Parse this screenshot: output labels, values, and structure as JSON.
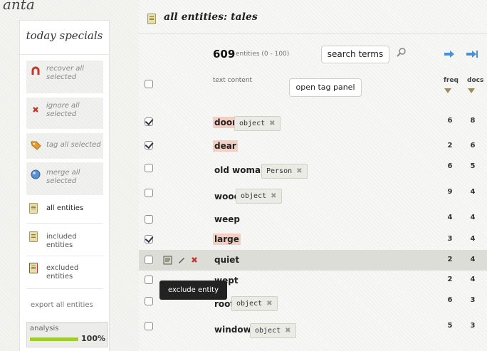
{
  "app": {
    "brand": "anta"
  },
  "sidebar": {
    "title": "today specials",
    "actions": [
      {
        "label": "recover all selected",
        "icon": "horseshoe-icon"
      },
      {
        "label": "ignore all selected",
        "icon": "red-x-icon"
      },
      {
        "label": "tag all selected",
        "icon": "tag-icon"
      },
      {
        "label": "merge all selected",
        "icon": "merge-icon"
      }
    ],
    "links": [
      {
        "label": "all entities",
        "icon": "document-icon"
      },
      {
        "label": "included entities",
        "icon": "document-check-icon"
      },
      {
        "label": "excluded entities",
        "icon": "document-excluded-icon"
      }
    ],
    "export_label": "export all entities",
    "analysis": {
      "label": "analysis",
      "progress": "100%",
      "progress_value": 1.0
    }
  },
  "main": {
    "title": "all entities: tales",
    "count": "609",
    "count_sub": "entities (0 - 100)",
    "search_button": "search terms",
    "columns": {
      "content": "text content",
      "freq": "freq",
      "docs": "docs"
    },
    "tag_panel_button": "open tag panel",
    "rows": [
      {
        "word": "door",
        "tag": "object",
        "freq": "6",
        "docs": "8",
        "checked": true,
        "highlighted": true
      },
      {
        "word": "dear",
        "tag": "",
        "freq": "2",
        "docs": "6",
        "checked": true,
        "highlighted": true
      },
      {
        "word": "old woman",
        "tag": "Person",
        "freq": "6",
        "docs": "5",
        "checked": false,
        "highlighted": false
      },
      {
        "word": "wood",
        "tag": "object",
        "freq": "9",
        "docs": "4",
        "checked": false,
        "highlighted": false
      },
      {
        "word": "weep",
        "tag": "",
        "freq": "4",
        "docs": "4",
        "checked": false,
        "highlighted": false
      },
      {
        "word": "large",
        "tag": "",
        "freq": "3",
        "docs": "4",
        "checked": true,
        "highlighted": true
      },
      {
        "word": "quiet",
        "tag": "",
        "freq": "2",
        "docs": "4",
        "checked": false,
        "highlighted": false
      },
      {
        "word": "wept",
        "tag": "",
        "freq": "2",
        "docs": "4",
        "checked": false,
        "highlighted": false
      },
      {
        "word": "roof",
        "tag": "object",
        "freq": "6",
        "docs": "3",
        "checked": false,
        "highlighted": false
      },
      {
        "word": "window",
        "tag": "object",
        "freq": "5",
        "docs": "3",
        "checked": false,
        "highlighted": false
      }
    ],
    "tag_remove_symbol": "✖",
    "tooltip": "exclude entity"
  },
  "colors": {
    "highlight": "#f3cfc3",
    "progress": "#9fcc2e",
    "row_hover": "#ddddd7"
  }
}
